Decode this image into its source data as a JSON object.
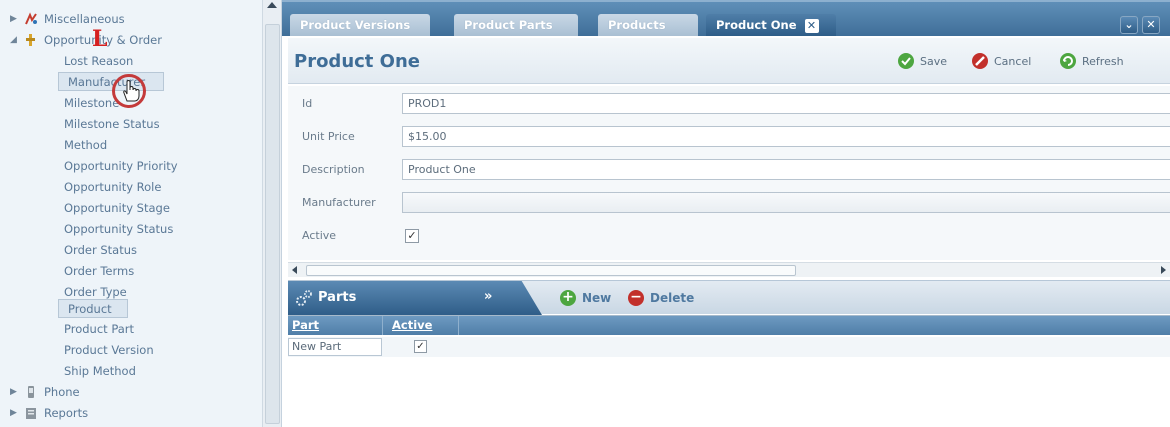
{
  "sidebar": {
    "groups": {
      "misc": "Miscellaneous",
      "opportunity": "Opportunity & Order",
      "phone": "Phone",
      "reports": "Reports"
    },
    "items": [
      "Lost Reason",
      "Manufacturer",
      "Milestone",
      "Milestone Status",
      "Method",
      "Opportunity Priority",
      "Opportunity Role",
      "Opportunity Stage",
      "Opportunity Status",
      "Order Status",
      "Order Terms",
      "Order Type",
      "Product",
      "Product Part",
      "Product Version",
      "Ship Method"
    ]
  },
  "tabs": {
    "t1": "Product Versions",
    "t2": "Product Parts",
    "t3": "Products",
    "t4": "Product One"
  },
  "panel": {
    "title": "Product One",
    "save": "Save",
    "cancel": "Cancel",
    "refresh": "Refresh"
  },
  "form": {
    "id_label": "Id",
    "id_value": "PROD1",
    "price_label": "Unit Price",
    "price_value": "$15.00",
    "desc_label": "Description",
    "desc_value": "Product One",
    "mfr_label": "Manufacturer",
    "mfr_value": "",
    "active_label": "Active",
    "active_checked": true
  },
  "parts": {
    "title": "Parts",
    "new": "New",
    "delete": "Delete",
    "columns": {
      "part": "Part",
      "active": "Active"
    },
    "rows": [
      {
        "part": "New Part",
        "active": true
      }
    ]
  },
  "colors": {
    "accent": "#3f6d97",
    "tab_active": "#2e5d88",
    "save_green": "#4da640",
    "cancel_red": "#c2302b"
  }
}
